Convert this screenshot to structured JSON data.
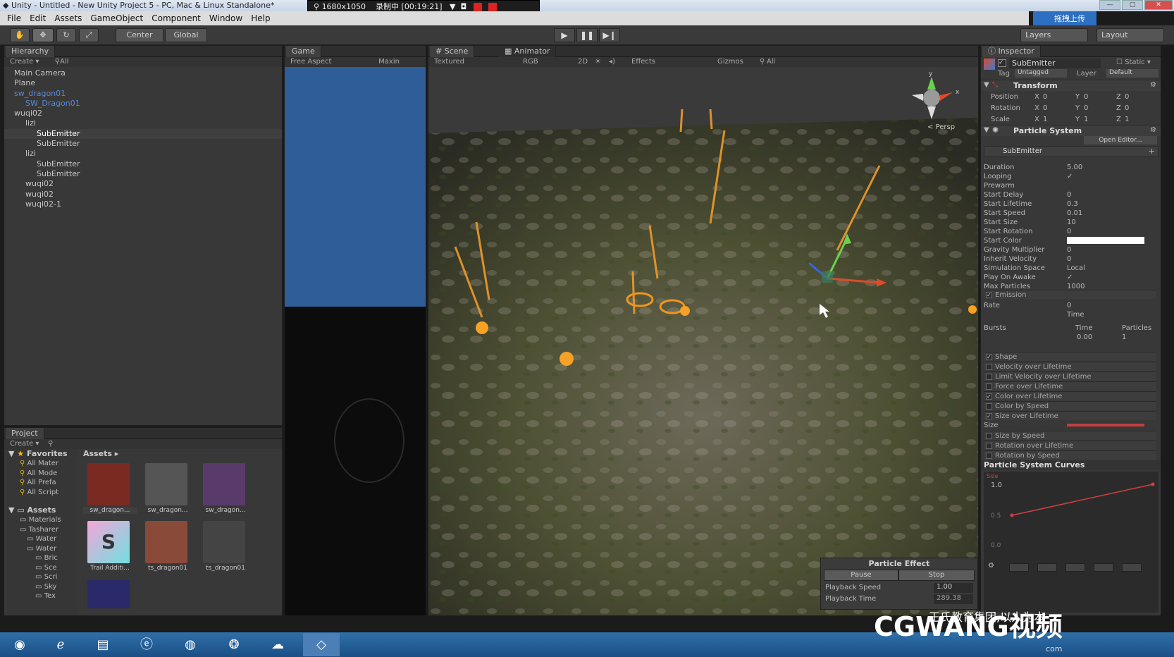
{
  "window": {
    "title": "Unity - Untitled - New Unity Project 5 - PC, Mac & Linux Standalone*",
    "resolution": "1680x1050",
    "recording": "录制中 [00:19:21]",
    "share_button": "拖拽上传"
  },
  "menu": [
    "File",
    "Edit",
    "Assets",
    "GameObject",
    "Component",
    "Window",
    "Help"
  ],
  "toolbar": {
    "pivot": "Center",
    "space": "Global",
    "layers": "Layers",
    "layout": "Layout"
  },
  "hierarchy": {
    "tab": "Hierarchy",
    "create": "Create",
    "search": "All",
    "items": [
      {
        "label": "Main Camera",
        "indent": 0,
        "style": "normal"
      },
      {
        "label": "Plane",
        "indent": 0,
        "style": "normal"
      },
      {
        "label": "sw_dragon01",
        "indent": 0,
        "style": "blue"
      },
      {
        "label": "SW_Dragon01",
        "indent": 1,
        "style": "blue"
      },
      {
        "label": "wuqi02",
        "indent": 0,
        "style": "normal"
      },
      {
        "label": "lizi",
        "indent": 1,
        "style": "normal"
      },
      {
        "label": "SubEmitter",
        "indent": 2,
        "style": "selected"
      },
      {
        "label": "SubEmitter",
        "indent": 2,
        "style": "normal"
      },
      {
        "label": "lizi",
        "indent": 1,
        "style": "normal"
      },
      {
        "label": "SubEmitter",
        "indent": 2,
        "style": "normal"
      },
      {
        "label": "SubEmitter",
        "indent": 2,
        "style": "normal"
      },
      {
        "label": "wuqi02",
        "indent": 1,
        "style": "normal"
      },
      {
        "label": "wuqi02",
        "indent": 1,
        "style": "normal"
      },
      {
        "label": "wuqi02-1",
        "indent": 1,
        "style": "normal"
      }
    ]
  },
  "game": {
    "tab": "Game",
    "aspect": "Free Aspect",
    "maximize": "Maxin"
  },
  "scene": {
    "tab": "Scene",
    "animator_tab": "Animator",
    "shading": "Textured",
    "rgb": "RGB",
    "mode2d": "2D",
    "effects": "Effects",
    "gizmos": "Gizmos",
    "search": "All",
    "persp": "Persp",
    "gizmo_y": "y",
    "gizmo_x": "x"
  },
  "project": {
    "tab": "Project",
    "create": "Create",
    "favorites_label": "Favorites",
    "favorites": [
      "All Mater",
      "All Mode",
      "All Prefa",
      "All Script"
    ],
    "assets_label": "Assets",
    "tree": [
      "Materials",
      "Tasharer",
      "Water",
      "Water",
      "Bric",
      "Sce",
      "Scri",
      "Sky",
      "Tex"
    ],
    "breadcrumb": "Assets",
    "thumbs": [
      {
        "label": "sw_dragon..."
      },
      {
        "label": "sw_dragon..."
      },
      {
        "label": "sw_dragon..."
      },
      {
        "label": "Trail Additi..."
      },
      {
        "label": "ts_dragon01"
      },
      {
        "label": "ts_dragon01"
      }
    ]
  },
  "particle_effect": {
    "title": "Particle Effect",
    "pause": "Pause",
    "stop": "Stop",
    "speed_label": "Playback Speed",
    "speed": "1.00",
    "time_label": "Playback Time",
    "time": "289.38"
  },
  "inspector": {
    "tab": "Inspector",
    "object": "SubEmitter",
    "static": "Static",
    "tag_label": "Tag",
    "tag": "Untagged",
    "layer_label": "Layer",
    "layer": "Default",
    "transform_title": "Transform",
    "transform": [
      {
        "label": "Position",
        "x": "0",
        "y": "0",
        "z": "0"
      },
      {
        "label": "Rotation",
        "x": "0",
        "y": "0",
        "z": "0"
      },
      {
        "label": "Scale",
        "x": "1",
        "y": "1",
        "z": "1"
      }
    ],
    "ps_title": "Particle System",
    "open_editor": "Open Editor...",
    "sub_name": "SubEmitter",
    "props": [
      {
        "label": "Duration",
        "value": "5.00"
      },
      {
        "label": "Looping",
        "value": "✓"
      },
      {
        "label": "Prewarm",
        "value": ""
      },
      {
        "label": "Start Delay",
        "value": "0"
      },
      {
        "label": "Start Lifetime",
        "value": "0.3"
      },
      {
        "label": "Start Speed",
        "value": "0.01"
      },
      {
        "label": "Start Size",
        "value": "10"
      },
      {
        "label": "Start Rotation",
        "value": "0"
      },
      {
        "label": "Start Color",
        "value": ""
      },
      {
        "label": "Gravity Multiplier",
        "value": "0"
      },
      {
        "label": "Inherit Velocity",
        "value": "0"
      },
      {
        "label": "Simulation Space",
        "value": "Local"
      },
      {
        "label": "Play On Awake",
        "value": "✓"
      },
      {
        "label": "Max Particles",
        "value": "1000"
      }
    ],
    "emission": "Emission",
    "rate_label": "Rate",
    "rate": "0",
    "time": "Time",
    "bursts_label": "Bursts",
    "burst_time_h": "Time",
    "burst_particles_h": "Particles",
    "burst_time": "0.00",
    "burst_particles": "1",
    "modules": [
      {
        "label": "Shape",
        "on": true
      },
      {
        "label": "Velocity over Lifetime",
        "on": false
      },
      {
        "label": "Limit Velocity over Lifetime",
        "on": false
      },
      {
        "label": "Force over Lifetime",
        "on": false
      },
      {
        "label": "Color over Lifetime",
        "on": true
      },
      {
        "label": "Color by Speed",
        "on": false
      },
      {
        "label": "Size over Lifetime",
        "on": true
      }
    ],
    "size_label": "Size",
    "modules2": [
      {
        "label": "Size by Speed",
        "on": false
      },
      {
        "label": "Rotation over Lifetime",
        "on": false
      },
      {
        "label": "Rotation by Speed",
        "on": false
      }
    ],
    "curves_title": "Particle System Curves",
    "curve_max": "1.0",
    "curve_mid": "0.5",
    "curve_min": "0.0",
    "curve_tag": "Size"
  },
  "watermark": {
    "text": "CGWANG视频",
    "sub": "王氏教育集团,以人为本",
    "url": "com"
  }
}
